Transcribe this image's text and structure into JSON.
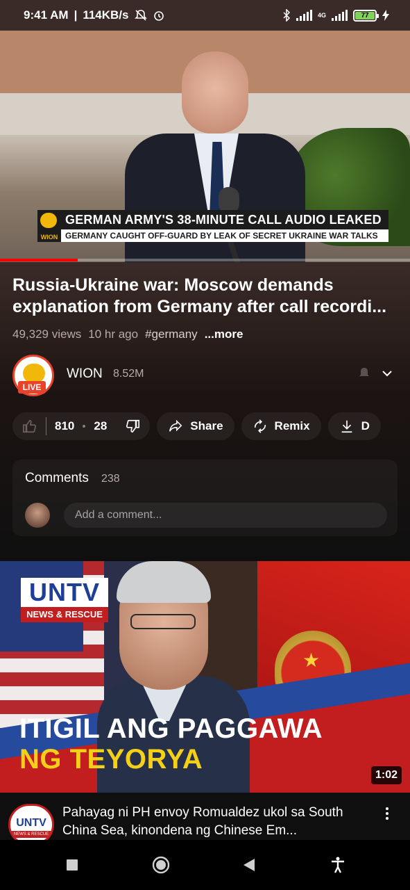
{
  "status_bar": {
    "time": "9:41 AM",
    "speed": "114KB/s",
    "network": "4G",
    "battery": "77"
  },
  "video": {
    "lower_third_title": "GERMAN ARMY'S 38-MINUTE CALL AUDIO LEAKED",
    "lower_third_sub": "GERMANY CAUGHT OFF-GUARD BY LEAK OF SECRET UKRAINE WAR TALKS",
    "lower_third_brand": "WION",
    "progress_fraction": 0.19
  },
  "info": {
    "title": "Russia-Ukraine war: Moscow demands explanation from Germany after call recordi...",
    "views": "49,329 views",
    "age": "10 hr ago",
    "hashtag": "#germany",
    "more": "...more"
  },
  "channel": {
    "name": "WION",
    "subscribers": "8.52M",
    "live_label": "LIVE"
  },
  "actions": {
    "likes": "810",
    "dislikes": "28",
    "share": "Share",
    "remix": "Remix",
    "download": "D"
  },
  "comments": {
    "label": "Comments",
    "count": "238",
    "placeholder": "Add a comment..."
  },
  "next_video": {
    "logo_top": "UNTV",
    "logo_bottom": "NEWS & RESCUE",
    "headline_1": "ITIGIL ANG PAGGAWA",
    "headline_2": "NG TEYORYA",
    "duration": "1:02",
    "title": "Pahayag ni PH envoy Romualdez ukol sa South China Sea, kinondena ng Chinese Em...",
    "avatar_text": "UNTV",
    "avatar_sub": "NEWS & RESCUE"
  },
  "colors": {
    "accent_red": "#ff0000",
    "wion_yellow": "#f2b70b",
    "untv_blue": "#1f3f96"
  }
}
